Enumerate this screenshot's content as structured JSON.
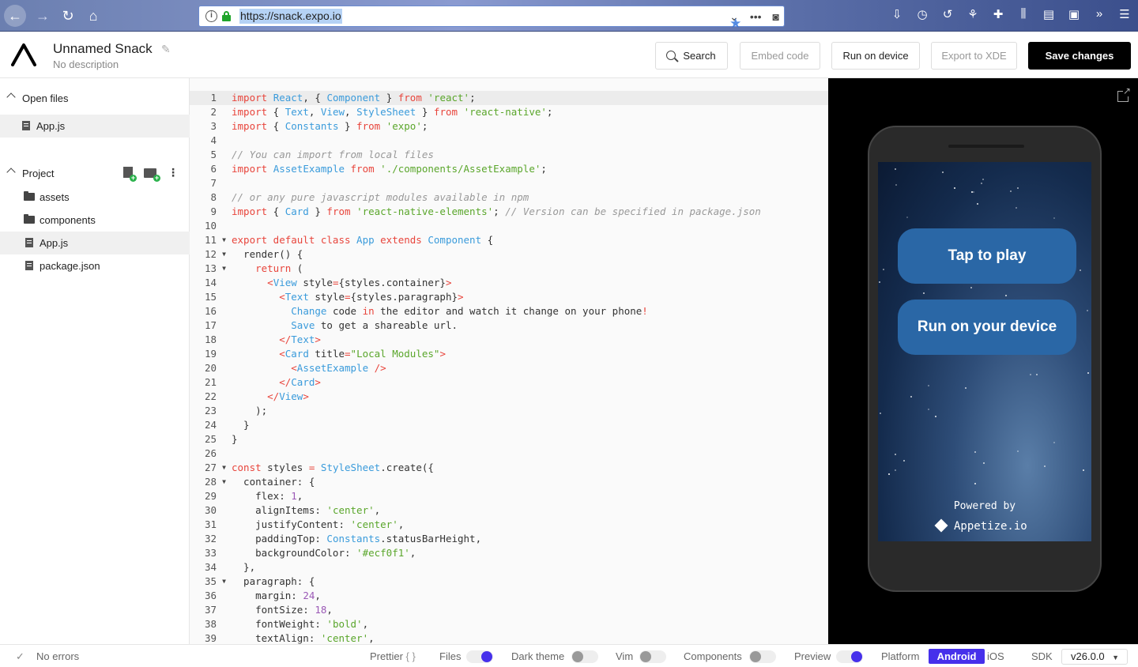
{
  "browser": {
    "url": "https://snack.expo.io"
  },
  "header": {
    "title": "Unnamed Snack",
    "description": "No description",
    "search_label": "Search",
    "embed_label": "Embed code",
    "run_label": "Run on device",
    "export_label": "Export to XDE",
    "save_label": "Save changes"
  },
  "sidebar": {
    "open_files_label": "Open files",
    "open_files": [
      "App.js"
    ],
    "project_label": "Project",
    "tree": [
      {
        "name": "assets",
        "type": "folder"
      },
      {
        "name": "components",
        "type": "folder"
      },
      {
        "name": "App.js",
        "type": "file",
        "selected": true
      },
      {
        "name": "package.json",
        "type": "file"
      }
    ]
  },
  "editor": {
    "lines": [
      [
        [
          "k",
          "import"
        ],
        [
          "p",
          " "
        ],
        [
          "t",
          "React"
        ],
        [
          "p",
          ", { "
        ],
        [
          "t",
          "Component"
        ],
        [
          "p",
          " } "
        ],
        [
          "k",
          "from"
        ],
        [
          "p",
          " "
        ],
        [
          "s",
          "'react'"
        ],
        [
          "p",
          ";"
        ]
      ],
      [
        [
          "k",
          "import"
        ],
        [
          "p",
          " { "
        ],
        [
          "t",
          "Text"
        ],
        [
          "p",
          ", "
        ],
        [
          "t",
          "View"
        ],
        [
          "p",
          ", "
        ],
        [
          "t",
          "StyleSheet"
        ],
        [
          "p",
          " } "
        ],
        [
          "k",
          "from"
        ],
        [
          "p",
          " "
        ],
        [
          "s",
          "'react-native'"
        ],
        [
          "p",
          ";"
        ]
      ],
      [
        [
          "k",
          "import"
        ],
        [
          "p",
          " { "
        ],
        [
          "t",
          "Constants"
        ],
        [
          "p",
          " } "
        ],
        [
          "k",
          "from"
        ],
        [
          "p",
          " "
        ],
        [
          "s",
          "'expo'"
        ],
        [
          "p",
          ";"
        ]
      ],
      [],
      [
        [
          "c",
          "// You can import from local files"
        ]
      ],
      [
        [
          "k",
          "import"
        ],
        [
          "p",
          " "
        ],
        [
          "t",
          "AssetExample"
        ],
        [
          "p",
          " "
        ],
        [
          "k",
          "from"
        ],
        [
          "p",
          " "
        ],
        [
          "s",
          "'./components/AssetExample'"
        ],
        [
          "p",
          ";"
        ]
      ],
      [],
      [
        [
          "c",
          "// or any pure javascript modules available in npm"
        ]
      ],
      [
        [
          "k",
          "import"
        ],
        [
          "p",
          " { "
        ],
        [
          "t",
          "Card"
        ],
        [
          "p",
          " } "
        ],
        [
          "k",
          "from"
        ],
        [
          "p",
          " "
        ],
        [
          "s",
          "'react-native-elements'"
        ],
        [
          "p",
          "; "
        ],
        [
          "c",
          "// Version can be specified in package.json"
        ]
      ],
      [],
      [
        [
          "k",
          "export default class"
        ],
        [
          "p",
          " "
        ],
        [
          "t",
          "App"
        ],
        [
          "p",
          " "
        ],
        [
          "k",
          "extends"
        ],
        [
          "p",
          " "
        ],
        [
          "t",
          "Component"
        ],
        [
          "p",
          " {"
        ]
      ],
      [
        [
          "p",
          "  render() {"
        ]
      ],
      [
        [
          "p",
          "    "
        ],
        [
          "k",
          "return"
        ],
        [
          "p",
          " ("
        ]
      ],
      [
        [
          "p",
          "      "
        ],
        [
          "k",
          "<"
        ],
        [
          "t",
          "View"
        ],
        [
          "p",
          " style"
        ],
        [
          "k",
          "="
        ],
        [
          "p",
          "{styles.container}"
        ],
        [
          "k",
          ">"
        ]
      ],
      [
        [
          "p",
          "        "
        ],
        [
          "k",
          "<"
        ],
        [
          "t",
          "Text"
        ],
        [
          "p",
          " style"
        ],
        [
          "k",
          "="
        ],
        [
          "p",
          "{styles.paragraph}"
        ],
        [
          "k",
          ">"
        ]
      ],
      [
        [
          "p",
          "          "
        ],
        [
          "t",
          "Change"
        ],
        [
          "p",
          " code "
        ],
        [
          "k",
          "in"
        ],
        [
          "p",
          " the editor and watch it change on your phone"
        ],
        [
          "k",
          "!"
        ]
      ],
      [
        [
          "p",
          "          "
        ],
        [
          "t",
          "Save"
        ],
        [
          "p",
          " to get a shareable url."
        ]
      ],
      [
        [
          "p",
          "        "
        ],
        [
          "k",
          "</"
        ],
        [
          "t",
          "Text"
        ],
        [
          "k",
          ">"
        ]
      ],
      [
        [
          "p",
          "        "
        ],
        [
          "k",
          "<"
        ],
        [
          "t",
          "Card"
        ],
        [
          "p",
          " title"
        ],
        [
          "k",
          "="
        ],
        [
          "s",
          "\"Local Modules\""
        ],
        [
          "k",
          ">"
        ]
      ],
      [
        [
          "p",
          "          "
        ],
        [
          "k",
          "<"
        ],
        [
          "t",
          "AssetExample"
        ],
        [
          "p",
          " "
        ],
        [
          "k",
          "/>"
        ]
      ],
      [
        [
          "p",
          "        "
        ],
        [
          "k",
          "</"
        ],
        [
          "t",
          "Card"
        ],
        [
          "k",
          ">"
        ]
      ],
      [
        [
          "p",
          "      "
        ],
        [
          "k",
          "</"
        ],
        [
          "t",
          "View"
        ],
        [
          "k",
          ">"
        ]
      ],
      [
        [
          "p",
          "    );"
        ]
      ],
      [
        [
          "p",
          "  }"
        ]
      ],
      [
        [
          "p",
          "}"
        ]
      ],
      [],
      [
        [
          "k",
          "const"
        ],
        [
          "p",
          " styles "
        ],
        [
          "k",
          "="
        ],
        [
          "p",
          " "
        ],
        [
          "t",
          "StyleSheet"
        ],
        [
          "p",
          ".create({"
        ]
      ],
      [
        [
          "p",
          "  container: {"
        ]
      ],
      [
        [
          "p",
          "    flex: "
        ],
        [
          "n",
          "1"
        ],
        [
          "p",
          ","
        ]
      ],
      [
        [
          "p",
          "    alignItems: "
        ],
        [
          "s",
          "'center'"
        ],
        [
          "p",
          ","
        ]
      ],
      [
        [
          "p",
          "    justifyContent: "
        ],
        [
          "s",
          "'center'"
        ],
        [
          "p",
          ","
        ]
      ],
      [
        [
          "p",
          "    paddingTop: "
        ],
        [
          "t",
          "Constants"
        ],
        [
          "p",
          ".statusBarHeight,"
        ]
      ],
      [
        [
          "p",
          "    backgroundColor: "
        ],
        [
          "s",
          "'#ecf0f1'"
        ],
        [
          "p",
          ","
        ]
      ],
      [
        [
          "p",
          "  },"
        ]
      ],
      [
        [
          "p",
          "  paragraph: {"
        ]
      ],
      [
        [
          "p",
          "    margin: "
        ],
        [
          "n",
          "24"
        ],
        [
          "p",
          ","
        ]
      ],
      [
        [
          "p",
          "    fontSize: "
        ],
        [
          "n",
          "18"
        ],
        [
          "p",
          ","
        ]
      ],
      [
        [
          "p",
          "    fontWeight: "
        ],
        [
          "s",
          "'bold'"
        ],
        [
          "p",
          ","
        ]
      ],
      [
        [
          "p",
          "    textAlign: "
        ],
        [
          "s",
          "'center'"
        ],
        [
          "p",
          ","
        ]
      ]
    ],
    "fold_lines": [
      11,
      12,
      13,
      27,
      28,
      35
    ]
  },
  "preview": {
    "tap_to_play": "Tap to play",
    "run_on_device": "Run on your device",
    "powered_by": "Powered by",
    "appetize": "Appetize.io"
  },
  "footer": {
    "status": "No errors",
    "prettier": "Prettier",
    "prettier_icon": "{ }",
    "files": "Files",
    "files_on": true,
    "dark_theme": "Dark theme",
    "dark_theme_on": false,
    "vim": "Vim",
    "vim_on": false,
    "components": "Components",
    "components_on": false,
    "preview": "Preview",
    "preview_on": true,
    "platform": "Platform",
    "platform_android": "Android",
    "platform_ios": "iOS",
    "sdk": "SDK",
    "sdk_version": "v26.0.0"
  },
  "colors": {
    "keyword": "#e8453c",
    "type": "#3a9bdb",
    "string": "#5aa62b",
    "comment": "#999999",
    "number": "#9b59b6",
    "accent": "#4630eb"
  }
}
